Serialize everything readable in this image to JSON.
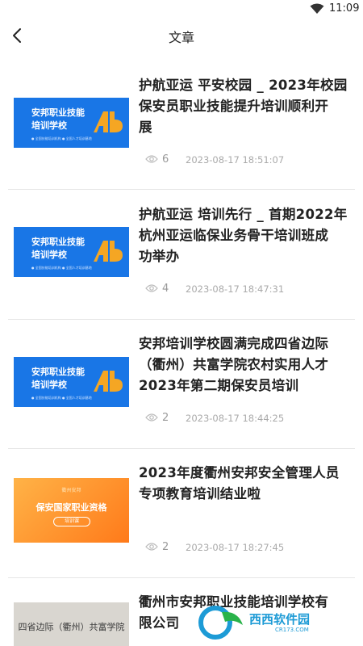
{
  "status_bar": {
    "time": "11:09",
    "wifi_icon": "wifi-icon"
  },
  "nav": {
    "back_icon": "chevron-left-icon",
    "title": "文章"
  },
  "articles": [
    {
      "title_line1": "护航亚运 平安校园 _ 2023年校园",
      "title_line2": "保安员职业技能提升培训顺利开",
      "title_line3": "展",
      "views": "6",
      "date": "2023-08-17 18:51:07",
      "thumb": {
        "line1": "安邦职业技能",
        "line2": "培训学校",
        "line3": "● 全国技能培训机构 ● 全国人才培训基地"
      }
    },
    {
      "title_line1": "护航亚运 培训先行 _ 首期2022年",
      "title_line2": "杭州亚运临保业务骨干培训班成",
      "title_line3": "功举办",
      "views": "4",
      "date": "2023-08-17 18:47:31",
      "thumb": {
        "line1": "安邦职业技能",
        "line2": "培训学校",
        "line3": "● 全国技能培训机构 ● 全国人才培训基地"
      }
    },
    {
      "title_line1": "安邦培训学校圆满完成四省边际",
      "title_line2": "（衢州）共富学院农村实用人才",
      "title_line3": "2023年第二期保安员培训",
      "views": "2",
      "date": "2023-08-17 18:44:25",
      "thumb": {
        "line1": "安邦职业技能",
        "line2": "培训学校",
        "line3": "● 全国技能培训机构 ● 全国人才培训基地"
      }
    },
    {
      "title_line1": "2023年度衢州安邦安全管理人员",
      "title_line2": "专项教育培训结业啦",
      "views": "2",
      "date": "2023-08-17 18:27:45",
      "thumb": {
        "line0": "衢州安邦",
        "line1": "保安国家职业资格",
        "line2": "培训课"
      }
    },
    {
      "title_line1": "衢州市安邦职业技能培训学校有",
      "title_line2": "限公司",
      "thumb": {
        "line1": "四省边际（衢州）共富学院"
      }
    }
  ],
  "watermark": {
    "text": "西西软件园",
    "sub": "CR173.COM"
  },
  "colors": {
    "thumb_blue": "#1976e6",
    "logo_orange": "#f5a623",
    "watermark_blue": "#1d9bd6"
  }
}
